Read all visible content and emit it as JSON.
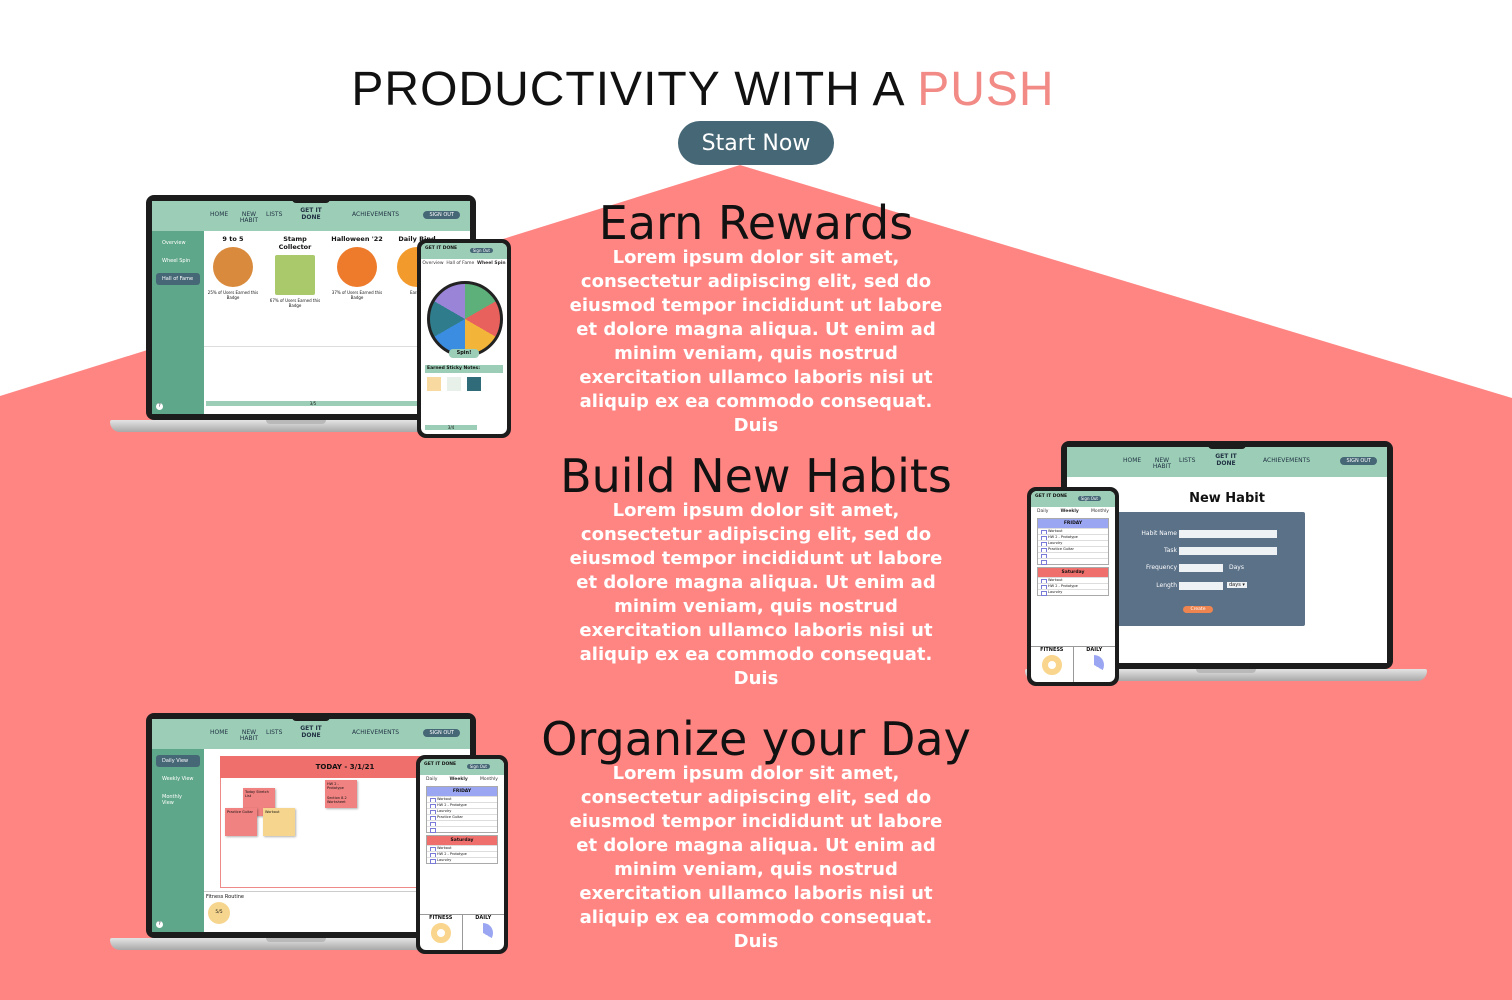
{
  "hero": {
    "title_main": "PRODUCTIVITY WITH A ",
    "title_accent": "PUSH",
    "cta_label": "Start Now"
  },
  "colors": {
    "background_shape": "#ff8583",
    "accent": "#f28b86",
    "cta": "#466776",
    "app_header": "#9cceb7",
    "app_sidebar": "#5fa78a"
  },
  "sections": [
    {
      "title": "Earn Rewards",
      "body": "Lorem ipsum dolor sit amet, consectetur adipiscing elit, sed do eiusmod tempor incididunt ut labore et dolore magna aliqua. Ut enim ad minim veniam, quis nostrud exercitation ullamco laboris nisi ut aliquip ex ea commodo consequat. Duis"
    },
    {
      "title": "Build New Habits",
      "body": "Lorem ipsum dolor sit amet, consectetur adipiscing elit, sed do eiusmod tempor incididunt ut labore et dolore magna aliqua. Ut enim ad minim veniam, quis nostrud exercitation ullamco laboris nisi ut aliquip ex ea commodo consequat. Duis"
    },
    {
      "title": "Organize your Day",
      "body": "Lorem ipsum dolor sit amet, consectetur adipiscing elit, sed do eiusmod tempor incididunt ut labore et dolore magna aliqua. Ut enim ad minim veniam, quis nostrud exercitation ullamco laboris nisi ut aliquip ex ea commodo consequat. Duis"
    }
  ],
  "app": {
    "nav": {
      "home": "HOME",
      "new_habit": "NEW HABIT",
      "lists": "LISTS",
      "logo": "GET IT DONE",
      "achievements": "ACHIEVEMENTS",
      "sign_out": "SIGN OUT"
    },
    "rewards_sidebar": [
      "Overview",
      "Wheel Spin",
      "Hall of Fame"
    ],
    "badges": [
      {
        "title": "9 to 5",
        "text": "25% of Users Earned this Badge",
        "color": "#d98a3c",
        "icon": "coffee-mug"
      },
      {
        "title": "Stamp Collector",
        "text": "67% of Users Earned this Badge",
        "color": "#a9c96a",
        "icon": "stamp"
      },
      {
        "title": "Halloween '22",
        "text": "37% of Users Earned this Badge",
        "color": "#ee7a2c",
        "icon": "pumpkin"
      },
      {
        "title": "Daily Rind",
        "text": "Earned",
        "color": "#f39a2c",
        "icon": "orange"
      }
    ],
    "rewards_progress": "3/5",
    "day_sidebar": [
      "Daily View",
      "Weekly View",
      "Monthly View"
    ],
    "today_label": "TODAY - 3/1/21",
    "sticky_notes": [
      "Today Stretch List",
      "HW 2 - Prototype",
      "Section 8.2 Worksheet",
      "Practice Guitar",
      "Workout"
    ],
    "fitness_label": "Fitness Routine",
    "fitness_progress": "5/5",
    "new_habit_form": {
      "title": "New Habit",
      "fields": [
        "Habit Name",
        "Task",
        "Frequency",
        "Length"
      ],
      "days_unit": "Days",
      "length_select": "days",
      "create_label": "Create"
    }
  },
  "phone": {
    "logo": "GET IT DONE",
    "sign_out": "Sign Out",
    "reward_tabs": [
      "Overview",
      "Hall of Fame",
      "Wheel Spin"
    ],
    "spin_label": "Spin!",
    "earned_label": "Earned Sticky Notes:",
    "progress": "3/4",
    "week_tabs": [
      "Daily",
      "Weekly",
      "Monthly"
    ],
    "friday": "FRIDAY",
    "saturday": "Saturday",
    "friday_tasks": [
      "Workout",
      "HW 2 - Prototype",
      "Laundry",
      "Practice Guitar"
    ],
    "saturday_tasks": [
      "Workout",
      "HW 2 - Prototype",
      "Laundry"
    ],
    "fitness": "FITNESS",
    "daily": "DAILY"
  }
}
